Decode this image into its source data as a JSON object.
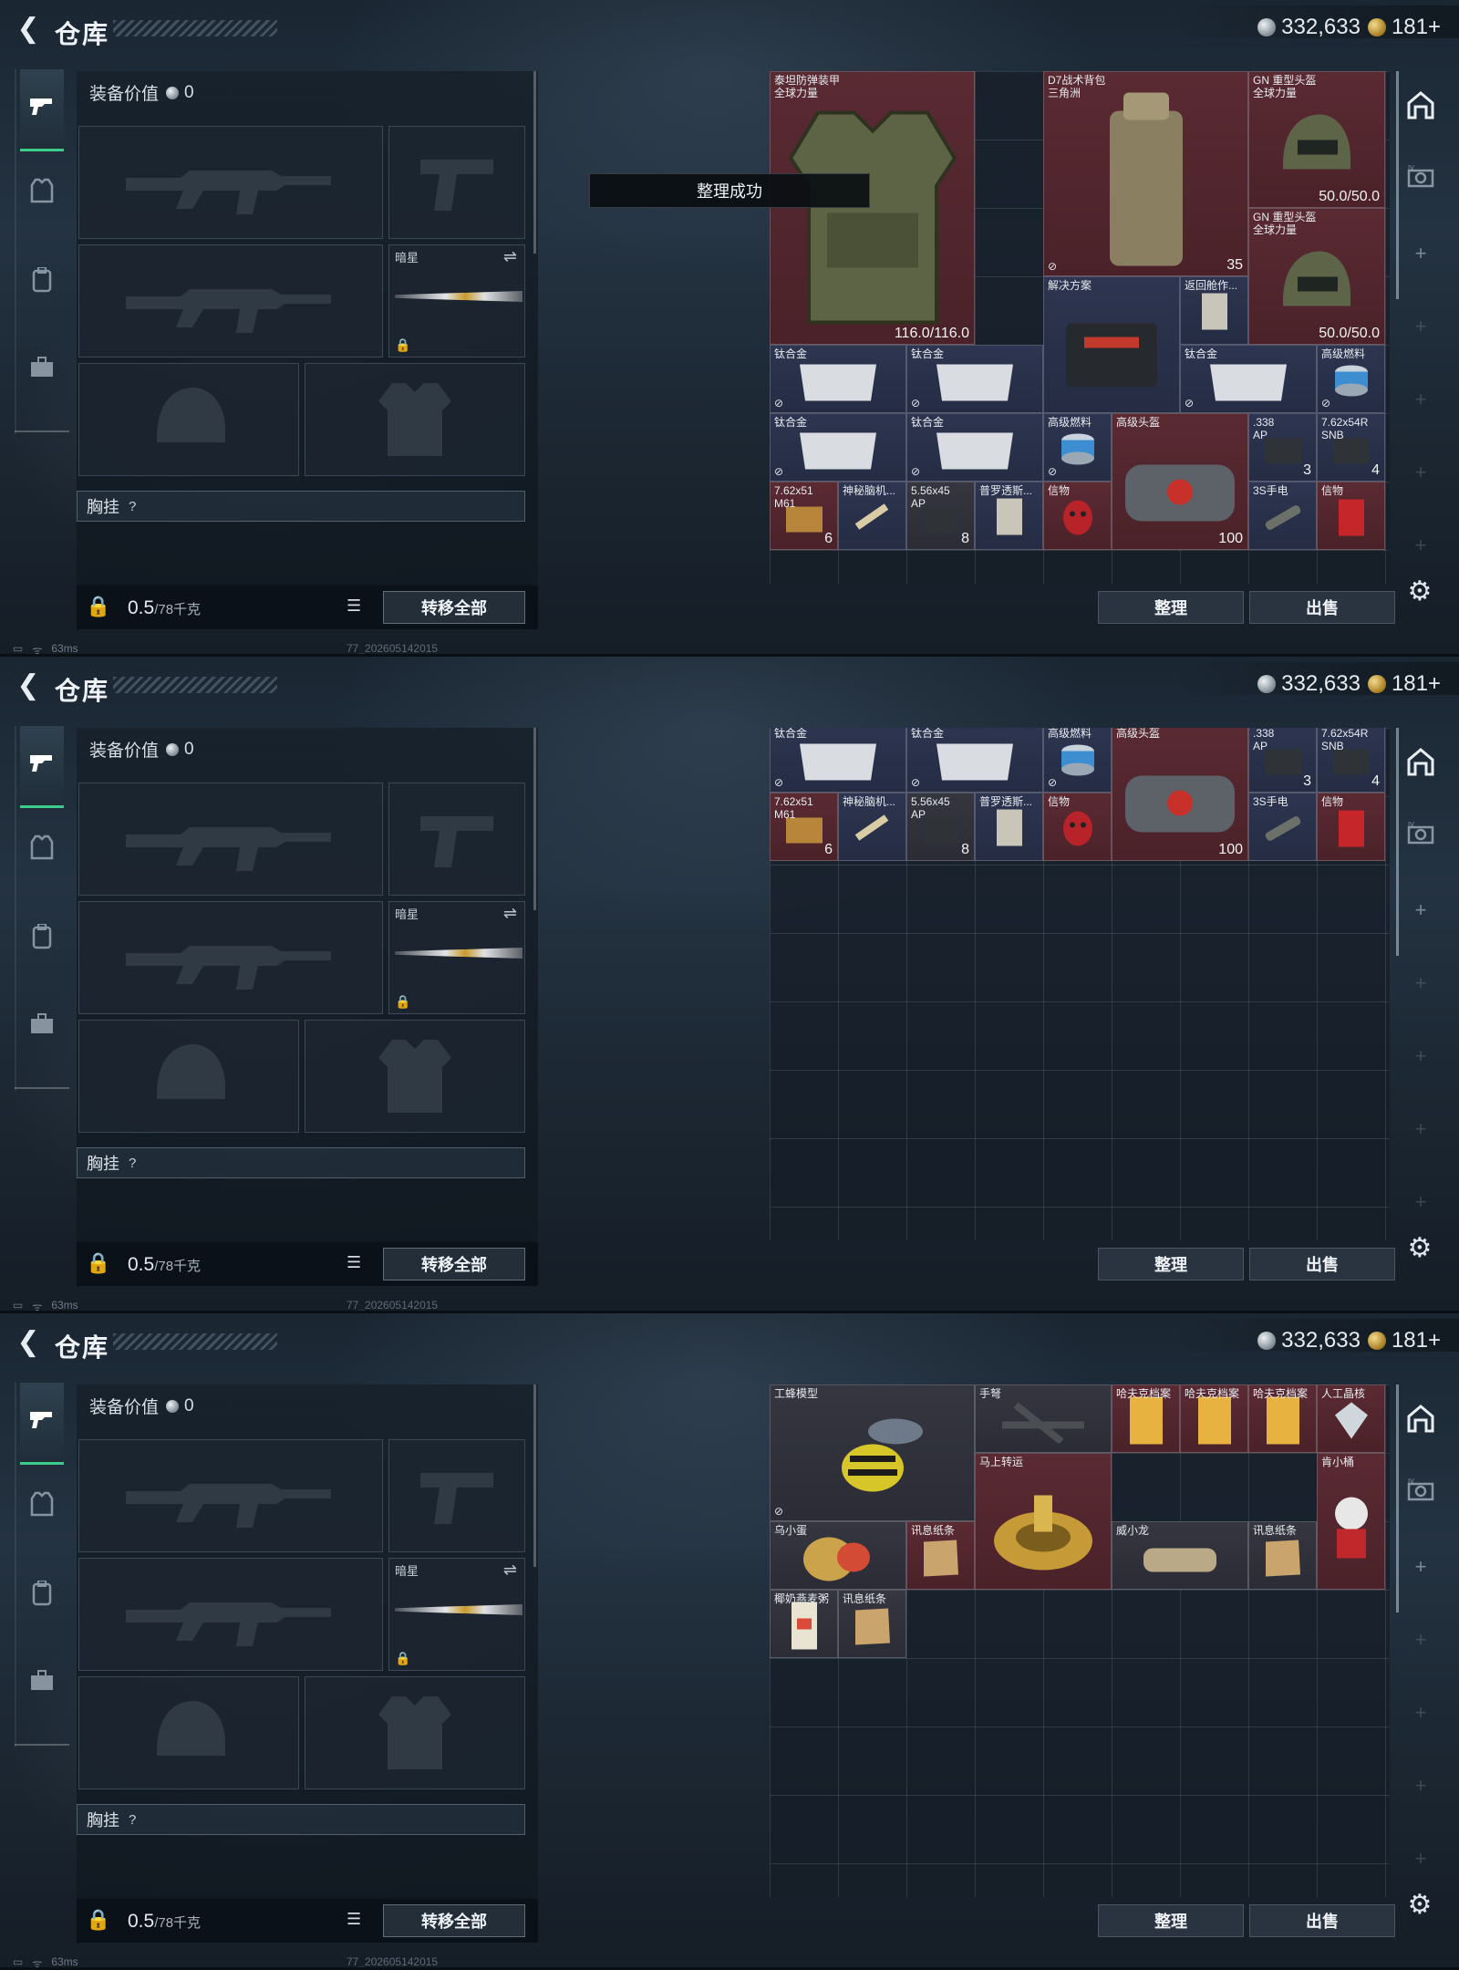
{
  "header": {
    "title": "仓库",
    "silver": "332,633",
    "gold": "181+"
  },
  "equipment": {
    "value_label": "装备价值",
    "value": "0",
    "secondary_label": "暗星",
    "chest_label": "胸挂",
    "chest_help": "?",
    "weight_value": "0.5",
    "weight_unit": "/78千克",
    "transfer_label": "转移全部"
  },
  "status": {
    "ping": "63ms",
    "build": "77_202605142015"
  },
  "storage": {
    "sort_label": "整理",
    "sell_label": "出售"
  },
  "toast": "整理成功",
  "icons": {
    "back": "chevron-left-icon",
    "weapon_tab": "pistol-icon",
    "armor_tab": "armor-icon",
    "backpack_tab": "backpack-icon",
    "case_tab": "briefcase-icon",
    "home": "arch-icon",
    "camera": "camera-icon",
    "plus": "plus-icon",
    "settings": "gear-icon"
  },
  "panel1_items": [
    {
      "name": "泰坦防弹装甲\n全球力量",
      "count": "116.0/116.0",
      "color": "red",
      "nosell": false
    },
    {
      "name": "D7战术背包\n三角洲",
      "count": "35",
      "color": "red",
      "nosell": true
    },
    {
      "name": "GN 重型头盔\n全球力量",
      "count": "50.0/50.0",
      "color": "red",
      "nosell": false
    },
    {
      "name": "GN 重型头盔\n全球力量",
      "count": "50.0/50.0",
      "color": "red",
      "nosell": false
    },
    {
      "name": "解决方案",
      "count": "",
      "color": "blue",
      "nosell": false
    },
    {
      "name": "返回舱作...",
      "count": "",
      "color": "blue",
      "nosell": false
    },
    {
      "name": "钛合金",
      "count": "",
      "color": "blue",
      "nosell": true
    },
    {
      "name": "钛合金",
      "count": "",
      "color": "blue",
      "nosell": true
    },
    {
      "name": "钛合金",
      "count": "",
      "color": "blue",
      "nosell": true
    },
    {
      "name": "高级燃料",
      "count": "",
      "color": "blue",
      "nosell": true
    },
    {
      "name": "钛合金",
      "count": "",
      "color": "blue",
      "nosell": true
    },
    {
      "name": "钛合金",
      "count": "",
      "color": "blue",
      "nosell": true
    },
    {
      "name": "高级燃料",
      "count": "",
      "color": "blue",
      "nosell": true
    },
    {
      "name": "高级头盔",
      "count": "100",
      "color": "red",
      "nosell": false
    },
    {
      "name": ".338\nAP",
      "count": "3",
      "color": "blue",
      "nosell": false
    },
    {
      "name": "7.62x54R\nSNB",
      "count": "4",
      "color": "blue",
      "nosell": false
    },
    {
      "name": "7.62x51\nM61",
      "count": "6",
      "color": "red",
      "nosell": false
    },
    {
      "name": "神秘脑机...",
      "count": "",
      "color": "blue",
      "nosell": false
    },
    {
      "name": "5.56x45\nAP",
      "count": "8",
      "color": "dark",
      "nosell": false
    },
    {
      "name": "普罗透斯...",
      "count": "",
      "color": "blue",
      "nosell": false
    },
    {
      "name": "信物",
      "count": "",
      "color": "red",
      "nosell": false
    },
    {
      "name": "3S手电",
      "count": "",
      "color": "blue",
      "nosell": false
    },
    {
      "name": "信物",
      "count": "",
      "color": "red",
      "nosell": false
    }
  ],
  "panel3_items": [
    {
      "name": "工蜂模型",
      "count": "",
      "color": "dark",
      "nosell": true
    },
    {
      "name": "手弩",
      "count": "",
      "color": "dark"
    },
    {
      "name": "哈夫克档案",
      "count": "",
      "color": "red"
    },
    {
      "name": "哈夫克档案",
      "count": "",
      "color": "red"
    },
    {
      "name": "哈夫克档案",
      "count": "",
      "color": "red"
    },
    {
      "name": "人工晶核",
      "count": "",
      "color": "red"
    },
    {
      "name": "马上转运",
      "count": "",
      "color": "red"
    },
    {
      "name": "肯小桶",
      "count": "",
      "color": "red"
    },
    {
      "name": "乌小蛋",
      "count": "",
      "color": "dark"
    },
    {
      "name": "讯息纸条",
      "count": "",
      "color": "red"
    },
    {
      "name": "威小龙",
      "count": "",
      "color": "dark"
    },
    {
      "name": "讯息纸条",
      "count": "",
      "color": "dark"
    },
    {
      "name": "椰奶燕麦粥",
      "count": "",
      "color": "dark"
    },
    {
      "name": "讯息纸条",
      "count": "",
      "color": "dark"
    }
  ]
}
